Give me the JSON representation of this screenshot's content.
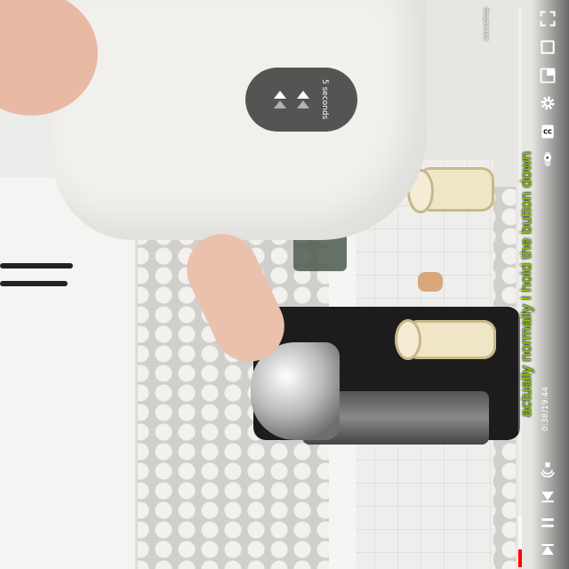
{
  "player": {
    "title": "saveshop",
    "caption": "actually normally I hold the button down",
    "seek_overlay": {
      "label": "5 seconds"
    },
    "time": {
      "current": "0:38",
      "separator": " / ",
      "duration": "19:44"
    },
    "progress_fraction": 0.032,
    "buffer_fraction": 0.09,
    "accent_color": "#ff0000",
    "caption_color": "#8fd400"
  },
  "controls": [
    {
      "name": "fullscreen-icon"
    },
    {
      "name": "theater-mode-icon"
    },
    {
      "name": "miniplayer-icon"
    },
    {
      "name": "settings-gear-icon"
    },
    {
      "name": "closed-captions-icon"
    },
    {
      "name": "autoplay-toggle-icon"
    },
    {
      "name": "volume-icon"
    },
    {
      "name": "next-icon"
    },
    {
      "name": "pause-icon"
    },
    {
      "name": "previous-icon"
    }
  ]
}
